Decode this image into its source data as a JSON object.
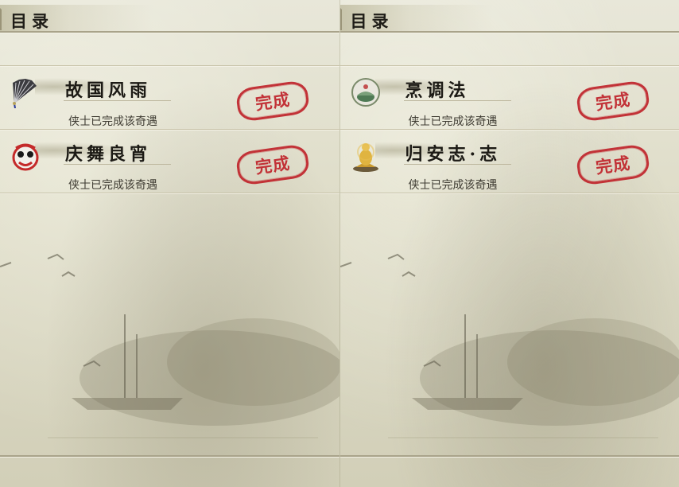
{
  "pages": [
    {
      "header_title": "目录",
      "entries": [
        {
          "name": "故国风雨",
          "status": "侠士已完成该奇遇",
          "stamp": "完成",
          "icon": "folding-fan-icon"
        },
        {
          "name": "庆舞良宵",
          "status": "侠士已完成该奇遇",
          "stamp": "完成",
          "icon": "lion-dance-mask-icon"
        }
      ]
    },
    {
      "header_title": "目录",
      "entries": [
        {
          "name": "烹调法",
          "status": "侠士已完成该奇遇",
          "stamp": "完成",
          "icon": "cooking-pot-icon"
        },
        {
          "name": "归安志·志",
          "status": "侠士已完成该奇遇",
          "stamp": "完成",
          "icon": "golden-buddha-icon"
        }
      ]
    }
  ],
  "colors": {
    "stamp_red": "#c0242b",
    "ink": "#1c1a15",
    "paper": "#e4e2d2"
  }
}
